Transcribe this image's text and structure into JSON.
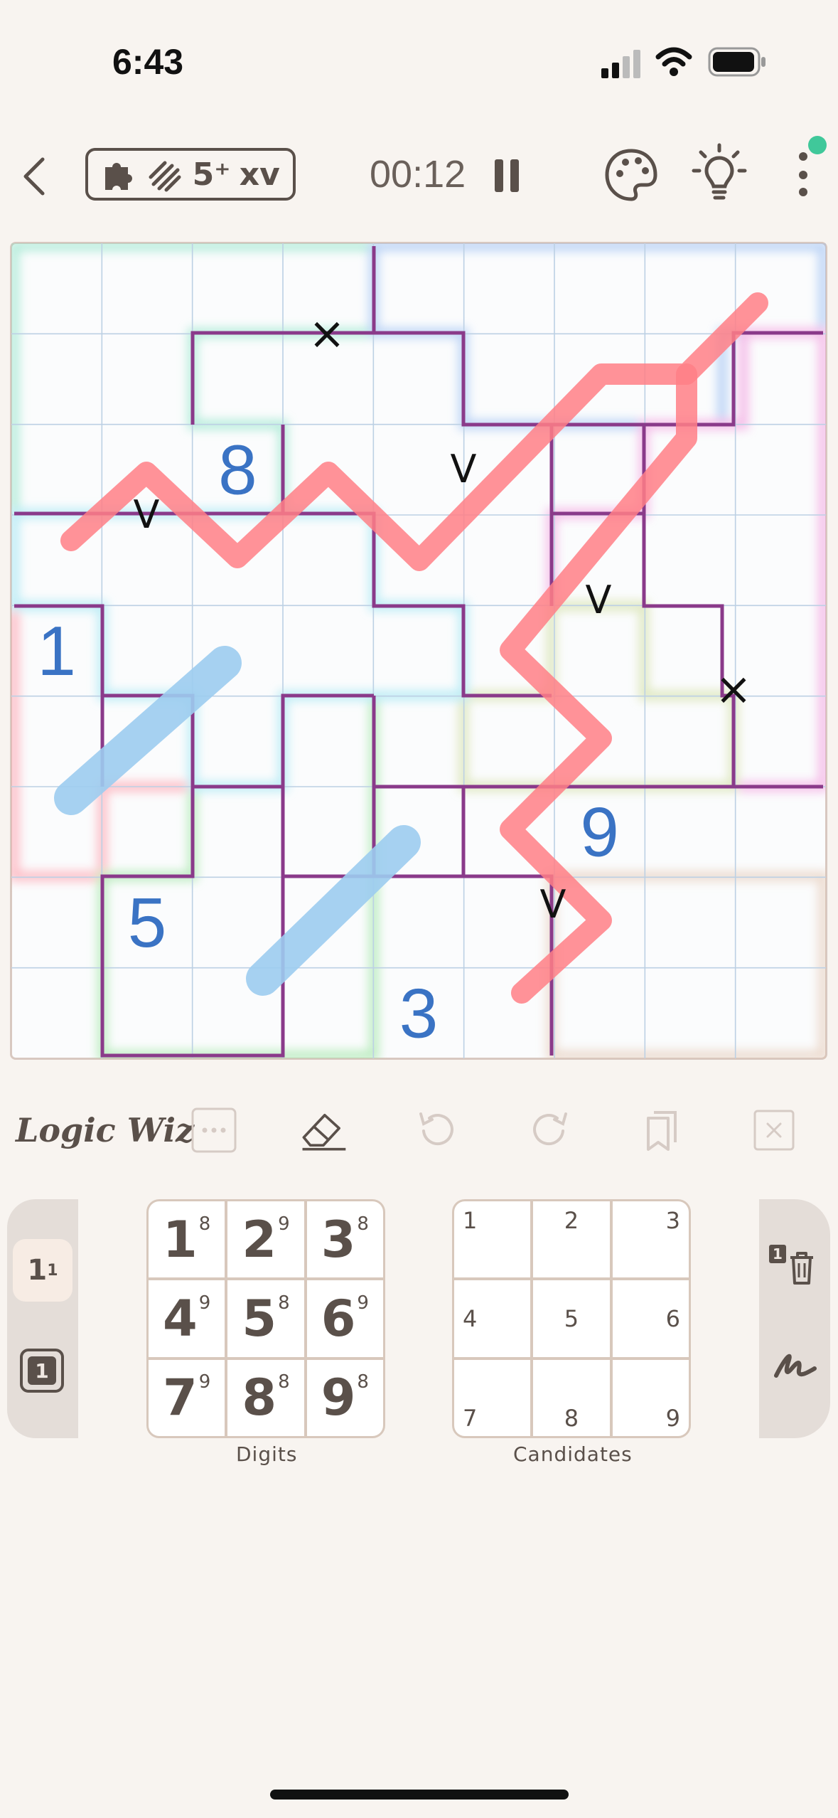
{
  "status_bar": {
    "time": "6:43"
  },
  "header": {
    "badge_icons": [
      "puzzle-icon",
      "diagonal-lines-icon"
    ],
    "badge_5plus": "5⁺",
    "badge_xv": "xv",
    "timer": "00:12"
  },
  "grid": {
    "size": 9,
    "given_digits": [
      {
        "row": 2,
        "col": 2,
        "value": "8"
      },
      {
        "row": 4,
        "col": 0,
        "value": "1"
      },
      {
        "row": 6,
        "col": 6,
        "value": "9"
      },
      {
        "row": 7,
        "col": 1,
        "value": "5"
      },
      {
        "row": 8,
        "col": 4,
        "value": "3"
      }
    ],
    "kropki_marks": [
      {
        "symbol": "×"
      },
      {
        "symbol": "V"
      },
      {
        "symbol": "V"
      },
      {
        "symbol": "V"
      },
      {
        "symbol": "×"
      },
      {
        "symbol": "V"
      }
    ],
    "colors": {
      "digit": "#3a73c4",
      "region_border": "#8a3a8a",
      "thermo_line": "#ff7f86",
      "blue_line": "#9dcdf0",
      "gridline": "#bcd0e4"
    }
  },
  "toolbar": {
    "brand": "Logic Wiz",
    "tools": [
      "more-icon",
      "eraser-icon",
      "undo-icon",
      "redo-icon",
      "copy-icon",
      "clear-icon"
    ]
  },
  "digits_pad": {
    "label": "Digits",
    "keys": [
      {
        "digit": "1",
        "count": "8"
      },
      {
        "digit": "2",
        "count": "9"
      },
      {
        "digit": "3",
        "count": "8"
      },
      {
        "digit": "4",
        "count": "9"
      },
      {
        "digit": "5",
        "count": "8"
      },
      {
        "digit": "6",
        "count": "9"
      },
      {
        "digit": "7",
        "count": "9"
      },
      {
        "digit": "8",
        "count": "8"
      },
      {
        "digit": "9",
        "count": "8"
      }
    ]
  },
  "candidates_pad": {
    "label": "Candidates",
    "keys": [
      "1",
      "2",
      "3",
      "4",
      "5",
      "6",
      "7",
      "8",
      "9"
    ]
  },
  "left_panel": {
    "mode_small": "1",
    "mode_small_sup": "1",
    "mode_box": "1"
  },
  "right_panel": {
    "delete_label": "1"
  }
}
